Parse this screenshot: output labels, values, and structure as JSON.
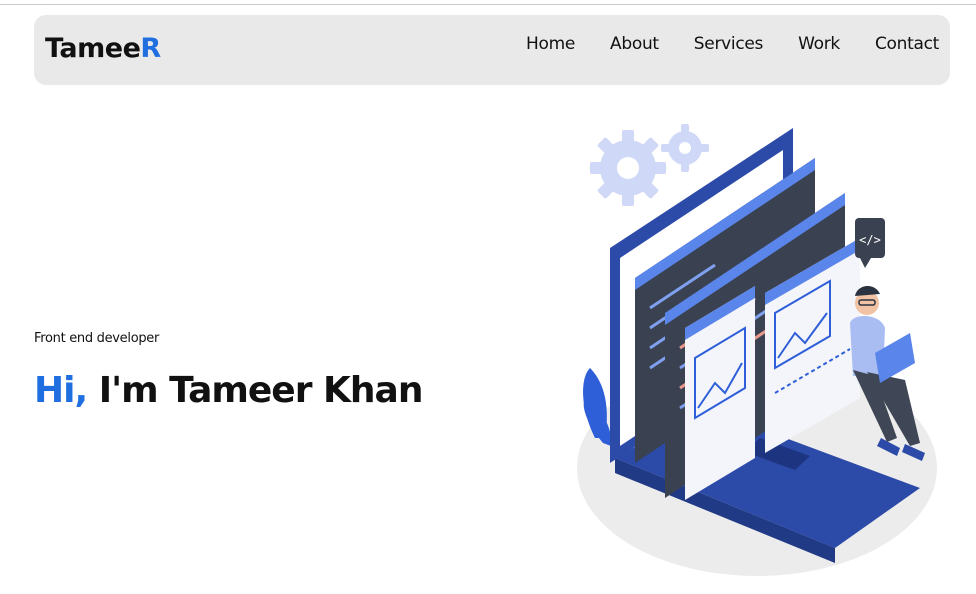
{
  "brand": {
    "prefix": "Tamee",
    "accent": "R"
  },
  "nav": {
    "items": [
      {
        "label": "Home"
      },
      {
        "label": "About"
      },
      {
        "label": "Services"
      },
      {
        "label": "Work"
      },
      {
        "label": "Contact"
      }
    ]
  },
  "hero": {
    "role": "Front end developer",
    "greeting": "Hi,",
    "name": "I'm Tameer Khan"
  },
  "illustration": {
    "code_icon": "</>"
  },
  "colors": {
    "accent": "#1f6fe0",
    "navbar_bg": "#e9e9e9",
    "illustration_blue": "#2f4fb0"
  }
}
